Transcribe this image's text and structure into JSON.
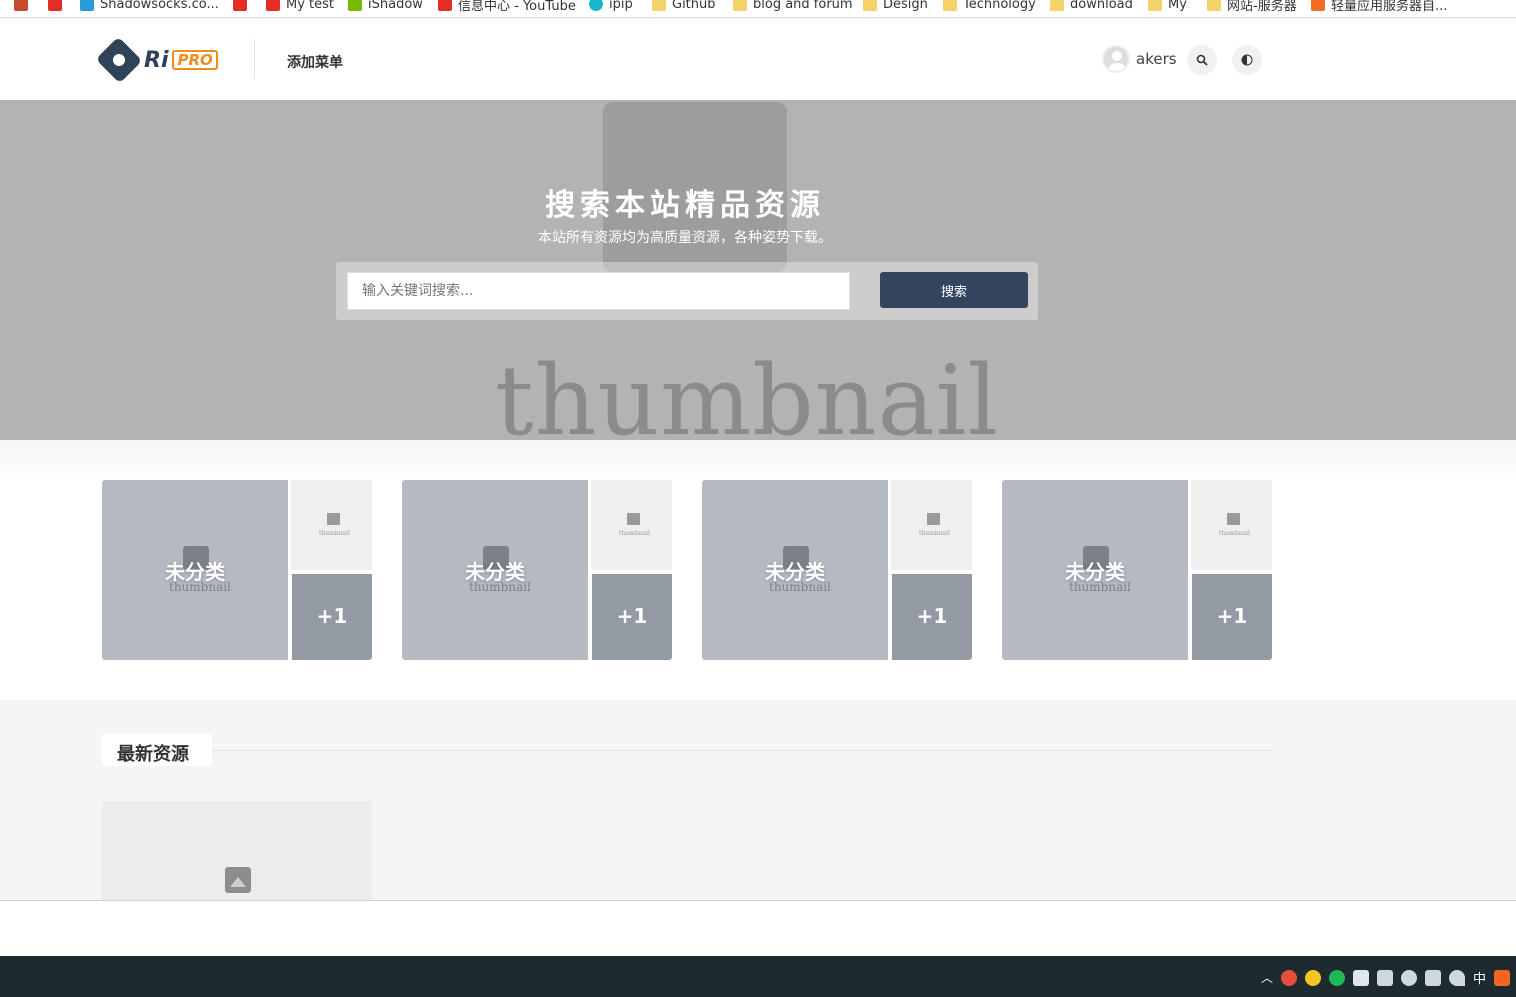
{
  "bookmarks": [
    {
      "label": "Shadowsocks.co...",
      "icon": "telegram-icon"
    },
    {
      "label": "My test",
      "icon": "youtube-icon"
    },
    {
      "label": "iShadow",
      "icon": "app-icon"
    },
    {
      "label": "信息中心 - YouTube",
      "icon": "youtube-icon"
    },
    {
      "label": "ipip",
      "icon": "ipip-icon"
    },
    {
      "label": "Github",
      "icon": "folder-icon"
    },
    {
      "label": "blog and forum",
      "icon": "folder-icon"
    },
    {
      "label": "Design",
      "icon": "folder-icon"
    },
    {
      "label": "Technology",
      "icon": "folder-icon"
    },
    {
      "label": "download",
      "icon": "folder-icon"
    },
    {
      "label": "My",
      "icon": "folder-icon"
    },
    {
      "label": "网站-服务器",
      "icon": "folder-icon"
    },
    {
      "label": "轻量应用服务器自...",
      "icon": "cloud-icon"
    }
  ],
  "header": {
    "logo_text": "Ri",
    "logo_badge": "PRO",
    "menu_label": "添加菜单",
    "username": "akers",
    "search_icon": "search-icon",
    "theme_icon": "theme-toggle-icon"
  },
  "hero": {
    "placeholder_text": "thumbnail",
    "title": "搜索本站精品资源",
    "subtitle": "本站所有资源均为高质量资源，各种姿势下载。",
    "search_placeholder": "输入关键词搜索...",
    "search_button": "搜索"
  },
  "categories": [
    {
      "name": "未分类",
      "extra": "+1",
      "thumb_text": "thumbnail",
      "mini_thumb_text": "thumbnail"
    },
    {
      "name": "未分类",
      "extra": "+1",
      "thumb_text": "thumbnail",
      "mini_thumb_text": "thumbnail"
    },
    {
      "name": "未分类",
      "extra": "+1",
      "thumb_text": "thumbnail",
      "mini_thumb_text": "thumbnail"
    },
    {
      "name": "未分类",
      "extra": "+1",
      "thumb_text": "thumbnail",
      "mini_thumb_text": "thumbnail"
    }
  ],
  "latest": {
    "title": "最新资源"
  },
  "taskbar": {
    "ime_label": "中"
  }
}
